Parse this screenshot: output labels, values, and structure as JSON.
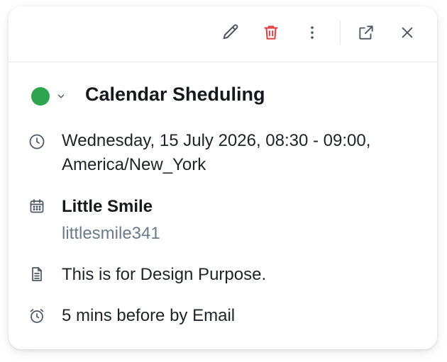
{
  "event": {
    "title": "Calendar Sheduling",
    "status_color": "#2ea44f",
    "datetime_line1": "Wednesday, 15 July 2026, 08:30 - 09:00,",
    "datetime_line2": "America/New_York",
    "calendar_name": "Little Smile",
    "calendar_user": "littlesmile341",
    "description": "This is for Design Purpose.",
    "reminder": "5 mins before by Email"
  },
  "toolbar": {
    "icons": [
      "pencil-icon",
      "trash-icon",
      "more-vertical-icon",
      "external-link-icon",
      "close-icon"
    ],
    "delete_color": "#e5383b"
  }
}
